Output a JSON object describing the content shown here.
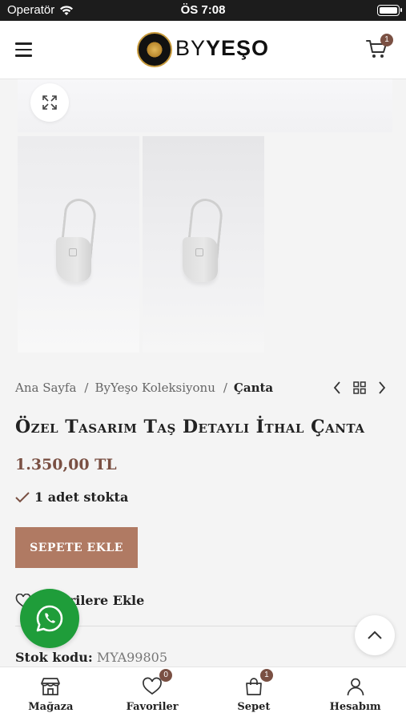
{
  "status_bar": {
    "carrier": "Operatör",
    "time": "ÖS 7:08"
  },
  "header": {
    "logo_text_by": "BY",
    "logo_text_yeso": "YEŞO",
    "cart_count": "1"
  },
  "breadcrumb": {
    "items": [
      "Ana Sayfa",
      "ByYeşo Koleksiyonu"
    ],
    "separator": "/",
    "current": "Çanta"
  },
  "product": {
    "title": "Özel Tasarım Taş Detaylı İthal Çanta",
    "price": "1.350,00 TL",
    "stock_text": "1 adet stokta",
    "add_to_cart_label": "SEPETE EKLE",
    "wishlist_label": "Favorilere Ekle",
    "sku_label": "Stok kodu:",
    "sku_value": "MYA99805"
  },
  "tabbar": {
    "items": [
      {
        "label": "Mağaza",
        "icon": "store-icon",
        "badge": ""
      },
      {
        "label": "Favoriler",
        "icon": "heart-icon",
        "badge": "0"
      },
      {
        "label": "Sepet",
        "icon": "bag-icon",
        "badge": "1"
      },
      {
        "label": "Hesabım",
        "icon": "user-icon",
        "badge": ""
      }
    ]
  },
  "colors": {
    "accent": "#7a5043",
    "button": "#b07a63",
    "whatsapp": "#1f9d3a"
  }
}
